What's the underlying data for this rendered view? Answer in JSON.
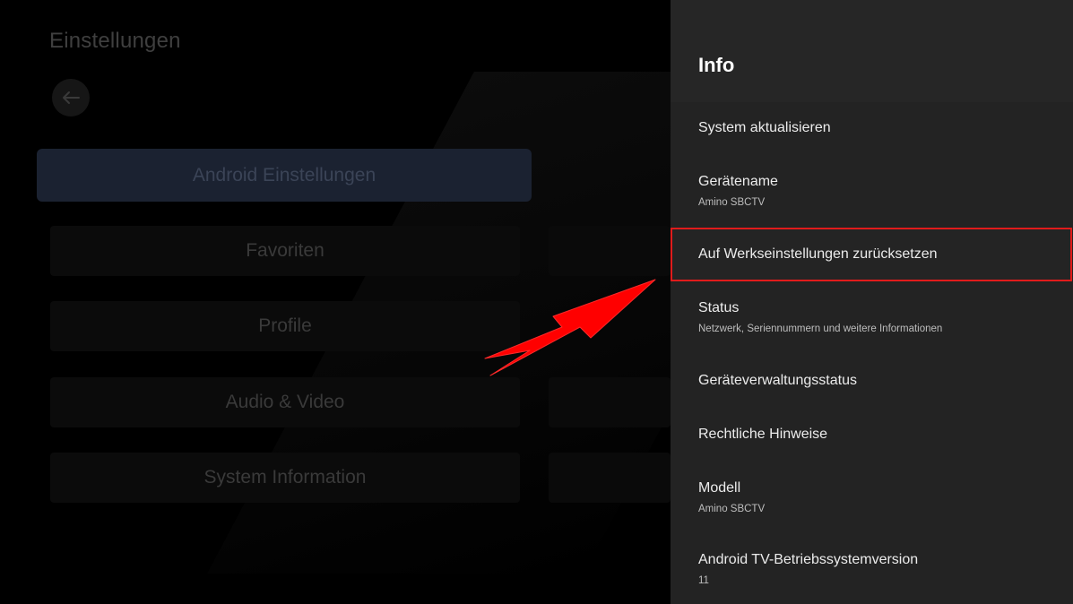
{
  "left": {
    "title": "Einstellungen",
    "back_icon": "arrow-left-icon",
    "tiles": [
      "Android Einstellungen",
      "Favoriten",
      "Profile",
      "Audio & Video",
      "System Information"
    ],
    "selected_tile": "Android Einstellungen"
  },
  "panel": {
    "title": "Info",
    "items": [
      {
        "label": "System aktualisieren",
        "sub": ""
      },
      {
        "label": "Gerätename",
        "sub": "Amino SBCTV"
      },
      {
        "label": "Auf Werkseinstellungen zurücksetzen",
        "sub": ""
      },
      {
        "label": "Status",
        "sub": "Netzwerk, Seriennummern und weitere Informationen"
      },
      {
        "label": "Geräteverwaltungsstatus",
        "sub": ""
      },
      {
        "label": "Rechtliche Hinweise",
        "sub": ""
      },
      {
        "label": "Modell",
        "sub": "Amino SBCTV"
      },
      {
        "label": "Android TV-Betriebssystemversion",
        "sub": "11"
      }
    ],
    "highlighted_item": "Auf Werkseinstellungen zurücksetzen"
  },
  "colors": {
    "highlight_border": "#e01b1b",
    "arrow": "#ff0000",
    "panel_bg": "#232323",
    "selected_tile_bg": "#1b2231"
  }
}
